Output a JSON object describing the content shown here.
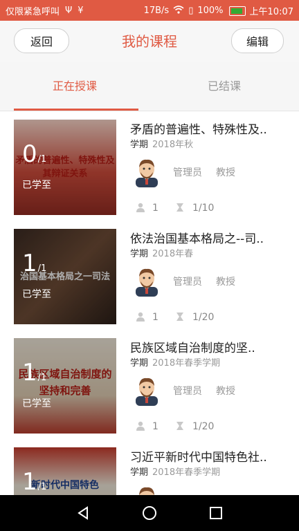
{
  "status_bar": {
    "carrier_text": "仅限紧急呼叫",
    "net_speed": "17B/s",
    "battery": "100%",
    "time": "上午10:07"
  },
  "header": {
    "back_label": "返回",
    "title": "我的课程",
    "edit_label": "编辑"
  },
  "tabs": [
    {
      "label": "正在授课"
    },
    {
      "label": "已结课"
    }
  ],
  "courses": [
    {
      "thumb_text": "矛盾的普遍性、特殊性及其辩证关系",
      "progress_done": "0",
      "progress_total": "/1",
      "studied_label": "已学至",
      "title": "矛盾的普遍性、特殊性及..",
      "term_label": "学期",
      "term": "2018年秋",
      "role": "管理员",
      "rank": "教授",
      "students": "1",
      "hours": "1/10"
    },
    {
      "thumb_text": "治国基本格局之一司法",
      "progress_done": "1",
      "progress_total": "/1",
      "studied_label": "已学至",
      "title": "依法治国基本格局之--司..",
      "term_label": "学期",
      "term": "2018年春",
      "role": "管理员",
      "rank": "教授",
      "students": "1",
      "hours": "1/20"
    },
    {
      "thumb_text": "民族区域自治制度的坚持和完善",
      "progress_done": "1",
      "progress_total": "/1",
      "studied_label": "已学至",
      "title": "民族区域自治制度的坚..",
      "term_label": "学期",
      "term": "2018年春季学期",
      "role": "管理员",
      "rank": "教授",
      "students": "1",
      "hours": "1/20"
    },
    {
      "thumb_text": "新时代中国特色",
      "progress_done": "1",
      "progress_total": "/1",
      "studied_label": "",
      "title": "习近平新时代中国特色社..",
      "term_label": "学期",
      "term": "2018年春季学期",
      "role": "管理员",
      "rank": "教授",
      "students": "",
      "hours": ""
    }
  ],
  "colors": {
    "accent": "#e05a43",
    "muted": "#999999"
  },
  "icons": {
    "back": "back-triangle-icon",
    "home": "home-circle-icon",
    "recent": "recent-square-icon",
    "student": "person-icon",
    "hours": "hourglass-icon"
  }
}
